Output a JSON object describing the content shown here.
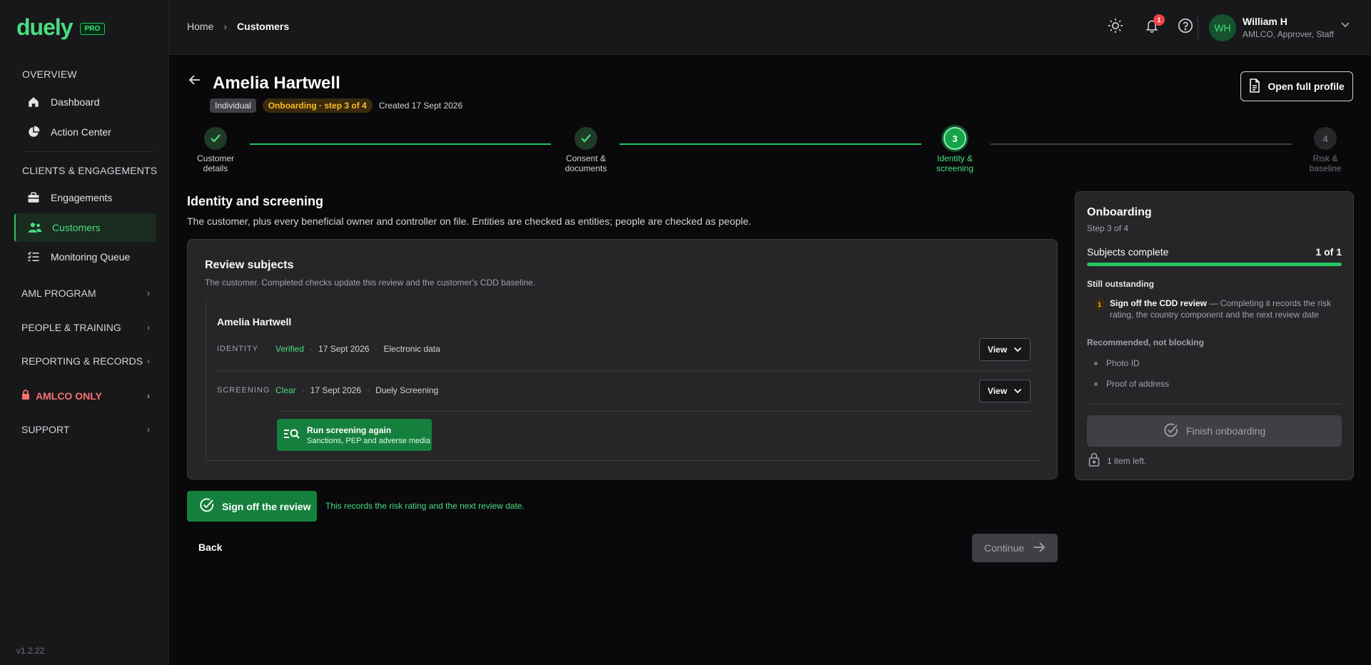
{
  "brand": {
    "name": "duely",
    "badge": "PRO"
  },
  "sidebar": {
    "overview_title": "OVERVIEW",
    "overview_items": [
      {
        "label": "Dashboard",
        "icon": "home-icon"
      },
      {
        "label": "Action Center",
        "icon": "pie-chart-icon"
      }
    ],
    "clients_title": "CLIENTS & ENGAGEMENTS",
    "clients_items": [
      {
        "label": "Engagements",
        "icon": "briefcase-icon"
      },
      {
        "label": "Customers",
        "icon": "users-icon",
        "active": true
      },
      {
        "label": "Monitoring Queue",
        "icon": "list-check-icon"
      }
    ],
    "groups": [
      {
        "label": "AML PROGRAM"
      },
      {
        "label": "PEOPLE & TRAINING"
      },
      {
        "label": "REPORTING & RECORDS"
      },
      {
        "label": "AMLCO ONLY",
        "icon": "lock-icon",
        "color": "#f87171"
      },
      {
        "label": "SUPPORT"
      }
    ],
    "version": "v1.2.22"
  },
  "topbar": {
    "breadcrumb": {
      "home": "Home",
      "current": "Customers"
    },
    "notifications_count": "1",
    "user": {
      "initials": "WH",
      "name": "William H",
      "roles": "AMLCO, Approver, Staff"
    }
  },
  "customer": {
    "name": "Amelia Hartwell",
    "type_tag": "Individual",
    "status_tag": "Onboarding · step 3 of 4",
    "created": "Created 17 Sept 2026",
    "open_profile_label": "Open full profile"
  },
  "stepper": {
    "steps": [
      {
        "line1": "Customer",
        "line2": "details",
        "state": "done"
      },
      {
        "line1": "Consent &",
        "line2": "documents",
        "state": "done"
      },
      {
        "number": "3",
        "line1": "Identity &",
        "line2": "screening",
        "state": "current"
      },
      {
        "number": "4",
        "line1": "Risk &",
        "line2": "baseline",
        "state": "todo"
      }
    ]
  },
  "section": {
    "title": "Identity and screening",
    "subtitle": "The customer, plus every beneficial owner and controller on file. Entities are checked as entities; people are checked as people."
  },
  "review": {
    "title": "Review subjects",
    "subtitle": "The customer. Completed checks update this review and the customer's CDD baseline.",
    "subject_name": "Amelia Hartwell",
    "checks": [
      {
        "label": "IDENTITY",
        "status": "Verified",
        "date": "17 Sept 2026",
        "source": "Electronic data",
        "view_label": "View"
      },
      {
        "label": "SCREENING",
        "status": "Clear",
        "date": "17 Sept 2026",
        "source": "Duely Screening",
        "view_label": "View"
      }
    ],
    "run_again": {
      "title": "Run screening again",
      "subtitle": "Sanctions, PEP and adverse media"
    }
  },
  "actions": {
    "signoff_label": "Sign off the review",
    "signoff_note": "This records the risk rating and the next review date.",
    "back_label": "Back",
    "continue_label": "Continue"
  },
  "onboarding_panel": {
    "title": "Onboarding",
    "step": "Step 3 of 4",
    "progress_label": "Subjects complete",
    "progress_value": "1 of 1",
    "progress_fraction": 1.0,
    "outstanding_title": "Still outstanding",
    "outstanding_num": "1",
    "outstanding_bold": "Sign off the CDD review",
    "outstanding_rest": " — Completing it records the risk rating, the country component and the next review date",
    "recommended_title": "Recommended, not blocking",
    "recommended_items": [
      "Photo ID",
      "Proof of address"
    ],
    "finish_label": "Finish onboarding",
    "items_left": "1 item left."
  }
}
